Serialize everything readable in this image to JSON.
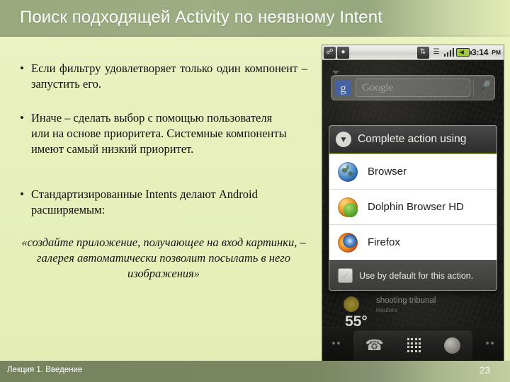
{
  "slide": {
    "title": "Поиск подходящей Activity по неявному Intent",
    "bullets": [
      {
        "marker": "•",
        "text": "Если фильтру удовлетворяет только один компонент – запустить его."
      },
      {
        "marker": "•",
        "text": "Иначе – сделать выбор с помощью пользователя или на основе приоритета. Системные компоненты имеют самый низкий приоритет."
      },
      {
        "marker": "•",
        "text": "Стандартизированные Intents делают Android расширяемым:"
      }
    ],
    "quote": "«создайте приложение, получающее на вход картинки, – галерея автоматически позволит посылать в него изображения»"
  },
  "footer": {
    "label": "Лекция 1. Введение",
    "page_number": "23"
  },
  "phone": {
    "statusbar": {
      "left_icons": [
        "usb-icon",
        "android-icon"
      ],
      "right_icons": [
        "sync-icon",
        "vibrate-icon",
        "signal-icon",
        "battery-icon"
      ],
      "time": "3:14",
      "ampm": "PM"
    },
    "search_widget": {
      "logo_letter": "g",
      "placeholder": "Google",
      "mic_icon": "microphone-icon"
    },
    "news_widget": {
      "headline": "shooting tribunal",
      "source": "Reuters",
      "temperature": "55°"
    },
    "dock": {
      "items": [
        "phone-icon",
        "app-grid-icon",
        "browser-globe-icon"
      ]
    },
    "dialog": {
      "header_icon": "chevron-down-circle-icon",
      "title": "Complete action using",
      "items": [
        {
          "label": "Browser",
          "icon": "browser-globe-icon"
        },
        {
          "label": "Dolphin Browser HD",
          "icon": "dolphin-icon"
        },
        {
          "label": "Firefox",
          "icon": "firefox-icon"
        }
      ],
      "checkbox": {
        "label": "Use by default for this action.",
        "checked": false
      }
    }
  }
}
